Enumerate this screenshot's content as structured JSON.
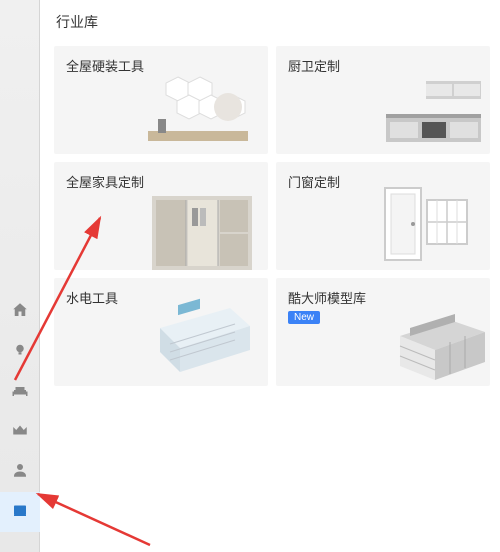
{
  "panel": {
    "title": "行业库"
  },
  "cards": [
    {
      "title": "全屋硬装工具",
      "badge": null
    },
    {
      "title": "厨卫定制",
      "badge": null
    },
    {
      "title": "全屋家具定制",
      "badge": null
    },
    {
      "title": "门窗定制",
      "badge": null
    },
    {
      "title": "水电工具",
      "badge": null
    },
    {
      "title": "酷大师模型库",
      "badge": "New"
    }
  ],
  "sidebar": {
    "icons": [
      {
        "name": "house-icon"
      },
      {
        "name": "bulb-icon"
      },
      {
        "name": "sofa-icon"
      },
      {
        "name": "crown-icon"
      },
      {
        "name": "user-icon"
      },
      {
        "name": "library-icon",
        "active": true
      }
    ]
  }
}
